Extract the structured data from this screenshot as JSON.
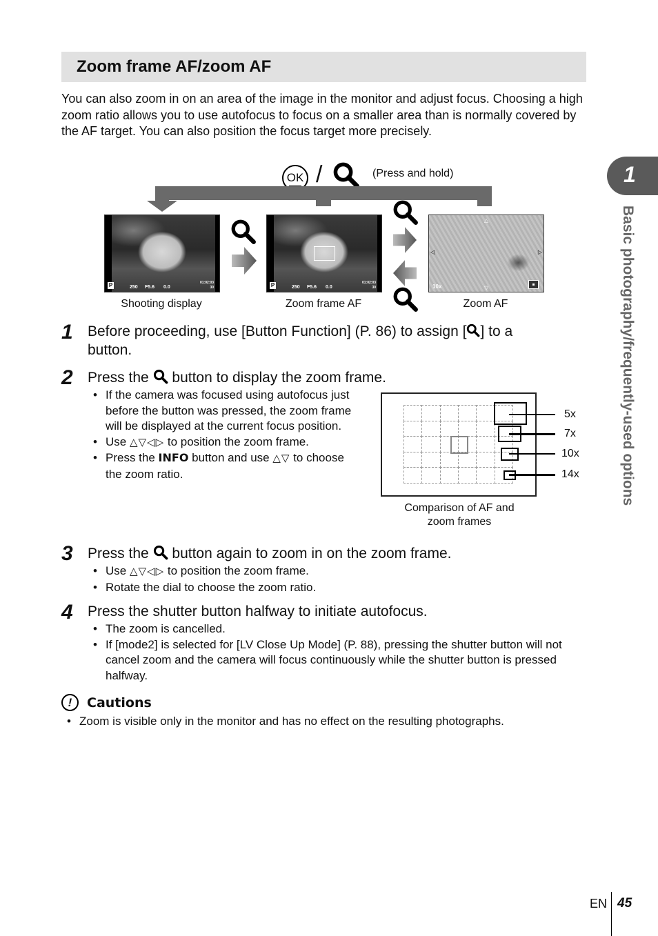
{
  "section": {
    "title": "Zoom frame AF/zoom AF"
  },
  "intro": "You can also zoom in on an area of the image in the monitor and adjust focus. Choosing a high zoom ratio allows you to use autofocus to focus on a smaller area than is normally covered by the AF target. You can also position the focus target more precisely.",
  "diagram": {
    "ok_label": "OK",
    "slash": "/",
    "press_hold": "(Press and hold)",
    "screens": [
      {
        "caption": "Shooting display",
        "mode": "P",
        "shutter": "250",
        "aperture": "F5.6",
        "ev": "0.0",
        "time": "01:02:03",
        "shots": "30"
      },
      {
        "caption": "Zoom frame AF",
        "mode": "P",
        "shutter": "250",
        "aperture": "F5.6",
        "ev": "0.0",
        "time": "01:02:03",
        "shots": "30"
      },
      {
        "caption": "Zoom AF",
        "zoom": "10x"
      }
    ]
  },
  "steps": [
    {
      "num": "1",
      "text_a": "Before proceeding, use [Button Function] (P. 86) to assign [",
      "text_b": "] to a",
      "text_c": "button."
    },
    {
      "num": "2",
      "text_a": "Press the",
      "text_b": "button to display the zoom frame.",
      "bullets": [
        "If the camera was focused using autofocus just before the button was pressed, the zoom frame will be displayed at the current focus position.",
        {
          "a": "Use",
          "icons": "△▽◁▷",
          "b": "to position the zoom frame."
        },
        {
          "a": "Press the",
          "bold": "INFO",
          "b": "button and use",
          "icons": "△▽",
          "c": "to choose the zoom ratio."
        }
      ]
    },
    {
      "num": "3",
      "text_a": "Press the",
      "text_b": "button again to zoom in on the zoom frame.",
      "bullets": [
        {
          "a": "Use",
          "icons": "△▽◁▷",
          "b": "to position the zoom frame."
        },
        "Rotate the dial to choose the zoom ratio."
      ]
    },
    {
      "num": "4",
      "text_a": "Press the shutter button halfway to initiate autofocus.",
      "bullets": [
        "The zoom is cancelled.",
        "If [mode2] is selected for [LV Close Up Mode] (P. 88), pressing the shutter button will not cancel zoom and the camera will focus continuously while the shutter button is pressed halfway."
      ]
    }
  ],
  "zoom_frames": {
    "labels": [
      "5x",
      "7x",
      "10x",
      "14x"
    ],
    "caption_1": "Comparison of AF and",
    "caption_2": "zoom frames"
  },
  "cautions": {
    "title": "Cautions",
    "items": [
      "Zoom is visible only in the monitor and has no effect on the resulting photographs."
    ]
  },
  "side_tab": {
    "number": "1",
    "text": "Basic photography/frequently-used options"
  },
  "footer": {
    "lang": "EN",
    "page": "45"
  },
  "colors": {
    "title_bar": "#e1e1e1",
    "arrow_gray": "#6a6a6a",
    "side_tab": "#5a5a5a",
    "side_text": "#666666"
  }
}
